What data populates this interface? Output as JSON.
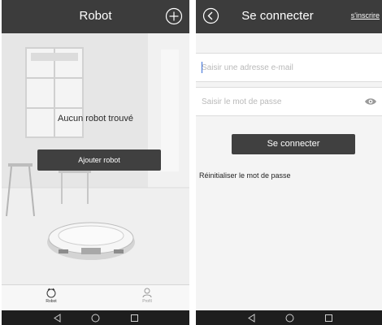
{
  "left_screen": {
    "header": {
      "title": "Robot",
      "add_icon": "plus-circle-icon"
    },
    "empty_message": "Aucun robot trouvé",
    "add_robot_label": "Ajouter robot",
    "tabs": [
      {
        "label": "Robot",
        "icon": "robot-vacuum-icon",
        "active": true
      },
      {
        "label": "Profil",
        "icon": "person-icon",
        "active": false
      }
    ]
  },
  "right_screen": {
    "header": {
      "title": "Se connecter",
      "back_icon": "back-arrow-icon",
      "signup_label": "s'inscrire"
    },
    "email": {
      "placeholder": "Saisir une adresse e-mail",
      "value": ""
    },
    "password": {
      "placeholder": "Saisir le mot de passe",
      "value": "",
      "toggle_icon": "eye-icon"
    },
    "login_label": "Se connecter",
    "reset_label": "Réinitialiser le mot de passe"
  },
  "system_nav": {
    "icons": [
      "back-triangle-icon",
      "home-circle-icon",
      "recents-square-icon"
    ]
  },
  "colors": {
    "header_bg": "#3c3c3c",
    "button_bg": "#404040",
    "nav_bg": "#1e1e1e",
    "page_bg": "#f4f4f4"
  }
}
